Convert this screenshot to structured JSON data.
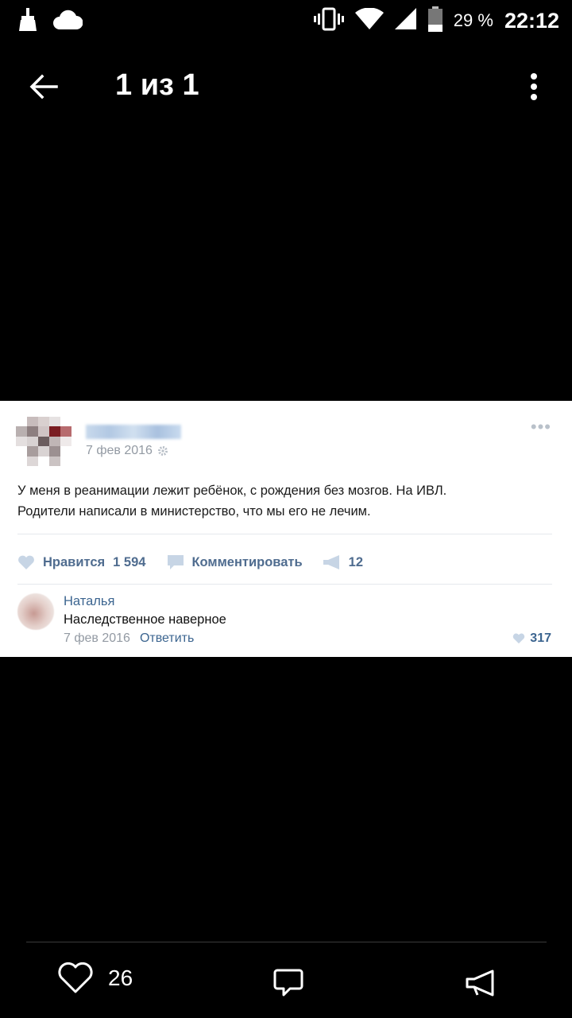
{
  "status_bar": {
    "battery_percent": "29 %",
    "time": "22:12",
    "icons": [
      "broom-icon",
      "cloud-icon",
      "vibrate-icon",
      "wifi-icon",
      "signal-icon",
      "battery-icon"
    ]
  },
  "toolbar": {
    "title": "1 из 1",
    "icons": [
      "back-arrow-icon",
      "more-vert-icon"
    ]
  },
  "post": {
    "date": "7 фев 2016",
    "text_line1": "У меня в реанимации лежит ребёнок, с рождения без мозгов. На ИВЛ.",
    "text_line2": "Родители написали в министерство, что мы его не лечим.",
    "like_label": "Нравится",
    "like_count": "1 594",
    "comment_label": "Комментировать",
    "share_count": "12"
  },
  "comment": {
    "author": "Наталья",
    "text": "Наследственное наверное",
    "date": "7 фев 2016",
    "reply_label": "Ответить",
    "likes": "317"
  },
  "bottom_bar": {
    "like_count": "26",
    "icons": [
      "heart-icon",
      "comment-icon",
      "share-icon"
    ]
  },
  "colors": {
    "background": "#000000",
    "link_blue": "#3c6590",
    "muted_gray": "#939aa3"
  }
}
